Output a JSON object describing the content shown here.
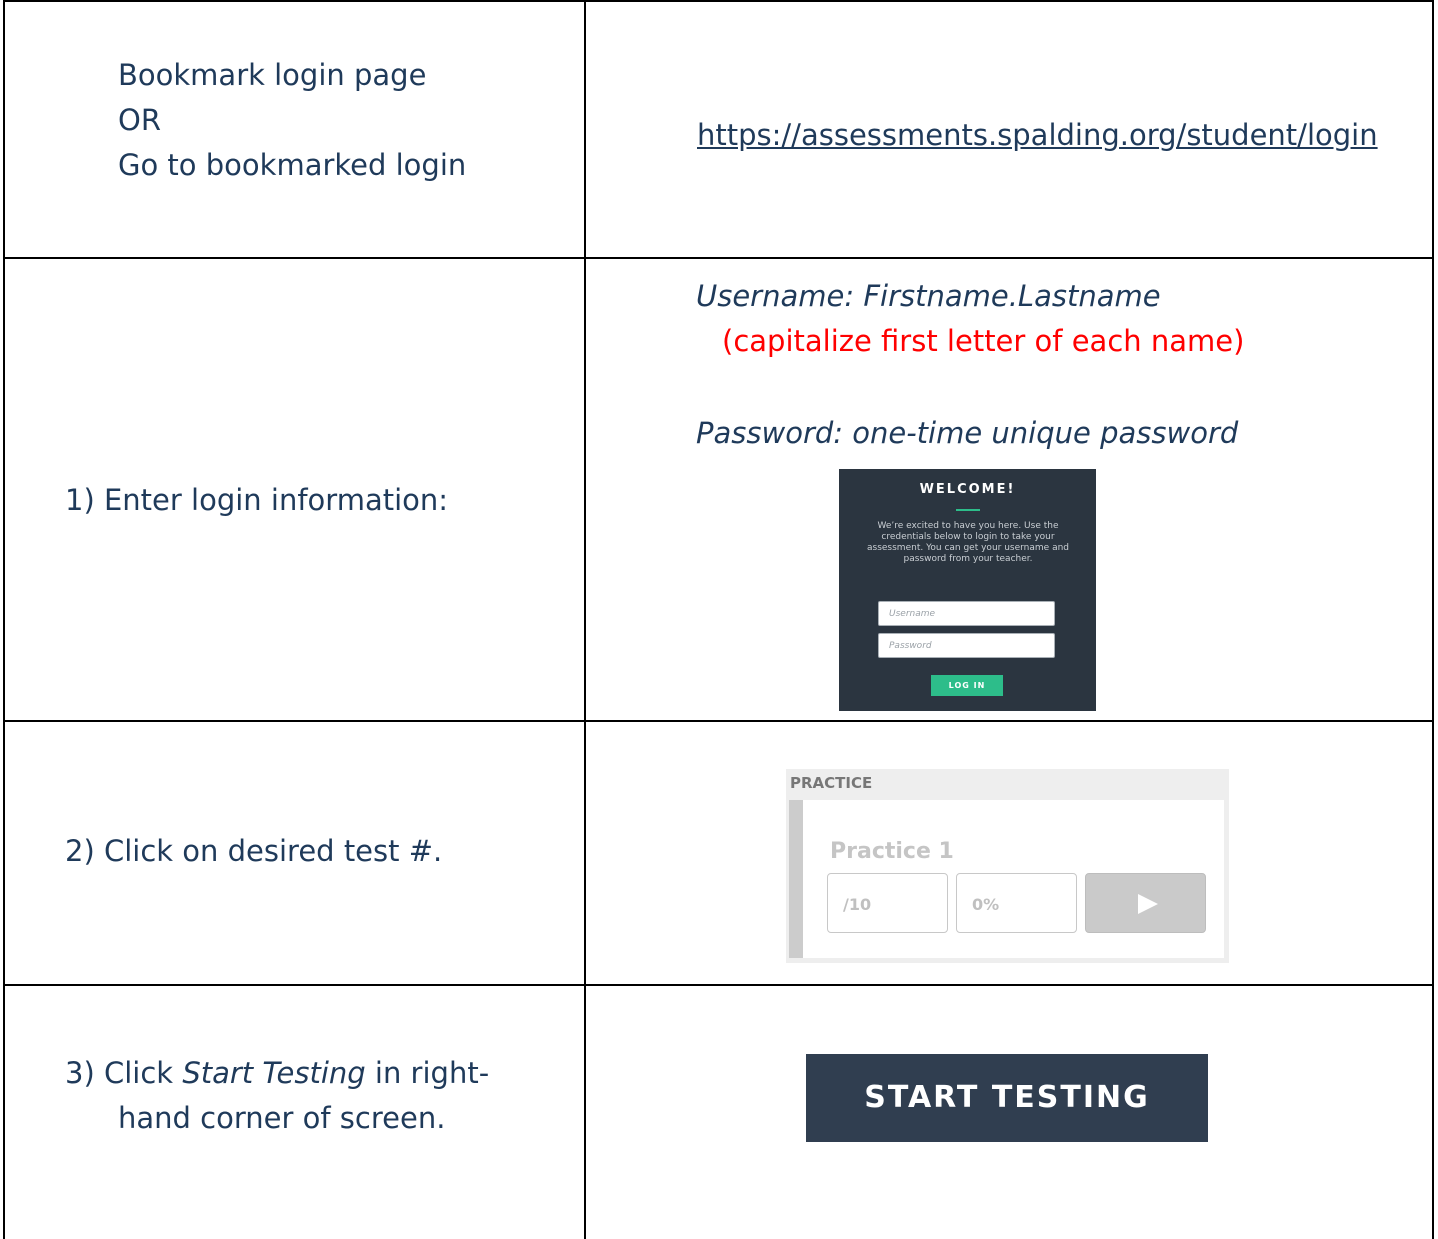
{
  "row0": {
    "line1": "Bookmark login page",
    "line2": "OR",
    "line3": "Go to bookmarked login",
    "url": "https://assessments.spalding.org/student/login"
  },
  "row1": {
    "step": "1) Enter login information:",
    "username_line": "Username: Firstname.Lastname",
    "username_note": "(capitalize first letter of each name)",
    "password_line": "Password: one-time unique password",
    "login_screen": {
      "title": "WELCOME!",
      "message": "We’re excited to have you here. Use the credentials below to login to take your assessment. You can get your username and password from your teacher.",
      "username_placeholder": "Username",
      "password_placeholder": "Password",
      "button": "LOG IN"
    }
  },
  "row2": {
    "step": "2) Click on desired test #.",
    "practice_screen": {
      "section_label": "PRACTICE",
      "test_name": "Practice 1",
      "score": "/10",
      "percent": "0%",
      "play_icon": "play-icon"
    }
  },
  "row3": {
    "step_prefix": "3)  Click ",
    "step_italic": "Start Testing",
    "step_suffix": " in right-",
    "step_line2": "hand corner of screen.",
    "button": "START TESTING"
  },
  "colors": {
    "text": "#1f3a5a",
    "note_red": "#ff0000",
    "login_bg": "#2b3540",
    "accent_green": "#2dbd8a",
    "start_button_bg": "#303e50"
  }
}
